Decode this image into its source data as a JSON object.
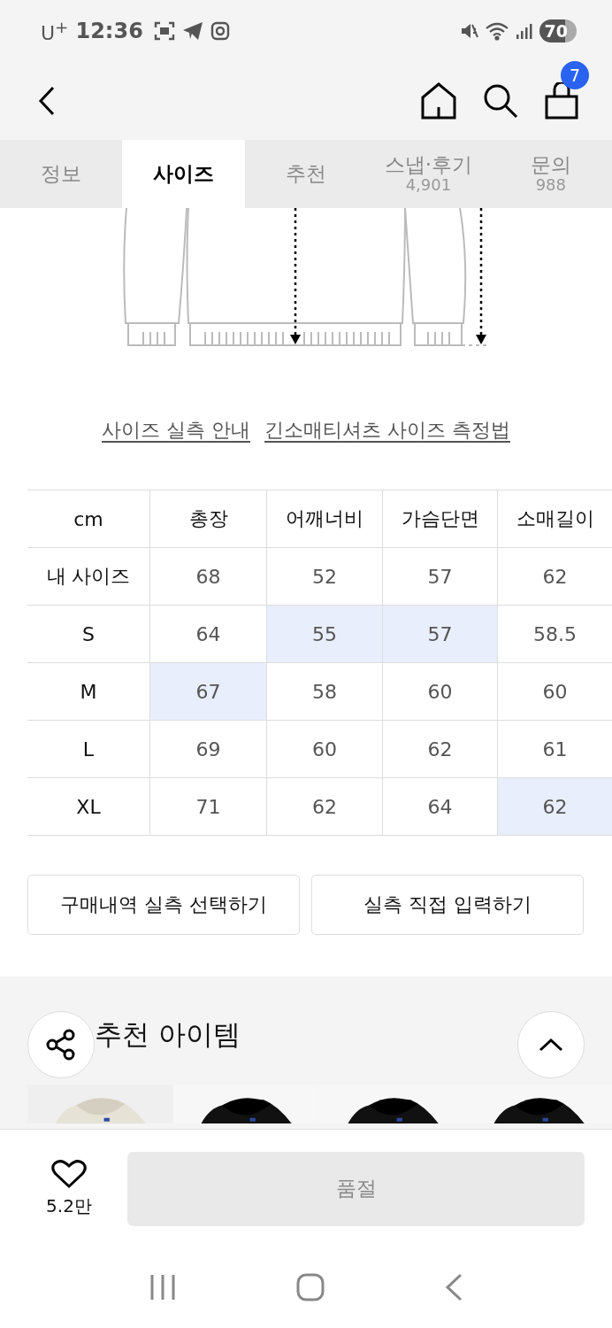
{
  "status_bar": {
    "carrier": "U$^{+}$",
    "time": "12:36",
    "battery": "70"
  },
  "header": {
    "cart_count": "7"
  },
  "tabs": [
    {
      "label": "정보",
      "selected": false
    },
    {
      "label": "사이즈",
      "selected": true
    },
    {
      "label": "추천",
      "selected": false
    },
    {
      "label": "스냅·후기",
      "count": "4,901",
      "selected": false
    },
    {
      "label": "문의",
      "count": "988",
      "selected": false
    }
  ],
  "size_guide": {
    "links": [
      "사이즈 실측 안내",
      "긴소매티셔츠 사이즈 측정법"
    ],
    "table": {
      "columns": [
        "cm",
        "총장",
        "어깨너비",
        "가슴단면",
        "소매길이"
      ],
      "rows": [
        {
          "cells": [
            {
              "text": "내 사이즈",
              "highlighted": false
            },
            {
              "text": "68",
              "highlighted": false
            },
            {
              "text": "52",
              "highlighted": false
            },
            {
              "text": "57",
              "highlighted": false
            },
            {
              "text": "62",
              "highlighted": false
            }
          ]
        },
        {
          "cells": [
            {
              "text": "S",
              "highlighted": false
            },
            {
              "text": "64",
              "highlighted": false
            },
            {
              "text": "55",
              "highlighted": true
            },
            {
              "text": "57",
              "highlighted": true
            },
            {
              "text": "58.5",
              "highlighted": false
            }
          ]
        },
        {
          "cells": [
            {
              "text": "M",
              "highlighted": false
            },
            {
              "text": "67",
              "highlighted": true
            },
            {
              "text": "58",
              "highlighted": false
            },
            {
              "text": "60",
              "highlighted": false
            },
            {
              "text": "60",
              "highlighted": false
            }
          ]
        },
        {
          "cells": [
            {
              "text": "L",
              "highlighted": false
            },
            {
              "text": "69",
              "highlighted": false
            },
            {
              "text": "60",
              "highlighted": false
            },
            {
              "text": "62",
              "highlighted": false
            },
            {
              "text": "61",
              "highlighted": false
            }
          ]
        },
        {
          "cells": [
            {
              "text": "XL",
              "highlighted": false
            },
            {
              "text": "71",
              "highlighted": false
            },
            {
              "text": "62",
              "highlighted": false
            },
            {
              "text": "64",
              "highlighted": false
            },
            {
              "text": "62",
              "highlighted": true
            }
          ]
        }
      ]
    },
    "buttons": [
      "구매내역 실측 선택하기",
      "실측 직접 입력하기"
    ]
  },
  "recommend": {
    "title": "추천 아이템"
  },
  "bottom_bar": {
    "likes": "5.2만",
    "buy_button": {
      "label": "품절",
      "disabled": true
    }
  }
}
